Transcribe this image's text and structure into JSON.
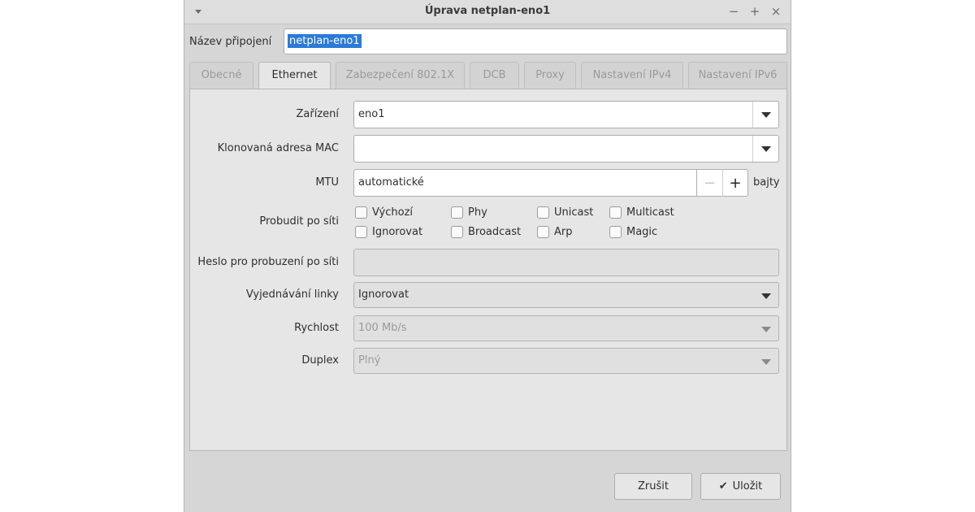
{
  "window": {
    "title": "Úprava netplan-eno1",
    "wm_buttons": [
      "−",
      "+",
      "×"
    ]
  },
  "connection": {
    "label": "Název připojení",
    "value": "netplan-eno1"
  },
  "tabs": [
    {
      "label": "Obecné",
      "active": false
    },
    {
      "label": "Ethernet",
      "active": true
    },
    {
      "label": "Zabezpečení 802.1X",
      "active": false
    },
    {
      "label": "DCB",
      "active": false
    },
    {
      "label": "Proxy",
      "active": false
    },
    {
      "label": "Nastavení IPv4",
      "active": false
    },
    {
      "label": "Nastavení IPv6",
      "active": false
    }
  ],
  "ethernet": {
    "device": {
      "label": "Zařízení",
      "value": "eno1"
    },
    "cloned_mac": {
      "label": "Klonovaná adresa MAC",
      "value": ""
    },
    "mtu": {
      "label": "MTU",
      "value": "automatické",
      "minus": "−",
      "plus": "+",
      "unit": "bajty"
    },
    "wol": {
      "label": "Probudit po síti",
      "options": [
        {
          "label": "Výchozí",
          "checked": false
        },
        {
          "label": "Phy",
          "checked": false
        },
        {
          "label": "Unicast",
          "checked": false
        },
        {
          "label": "Multicast",
          "checked": false
        },
        {
          "label": "Ignorovat",
          "checked": false
        },
        {
          "label": "Broadcast",
          "checked": false
        },
        {
          "label": "Arp",
          "checked": false
        },
        {
          "label": "Magic",
          "checked": false
        }
      ]
    },
    "wol_password": {
      "label": "Heslo pro probuzení po síti",
      "value": ""
    },
    "link_negotiation": {
      "label": "Vyjednávání linky",
      "value": "Ignorovat"
    },
    "speed": {
      "label": "Rychlost",
      "value": "100 Mb/s"
    },
    "duplex": {
      "label": "Duplex",
      "value": "Plný"
    }
  },
  "buttons": {
    "cancel": "Zrušit",
    "save": "Uložit",
    "save_icon": "✔"
  },
  "icons": {
    "window_menu": "chevron-down-icon",
    "dropdown": "triangle-down-icon",
    "check": "check-icon"
  }
}
